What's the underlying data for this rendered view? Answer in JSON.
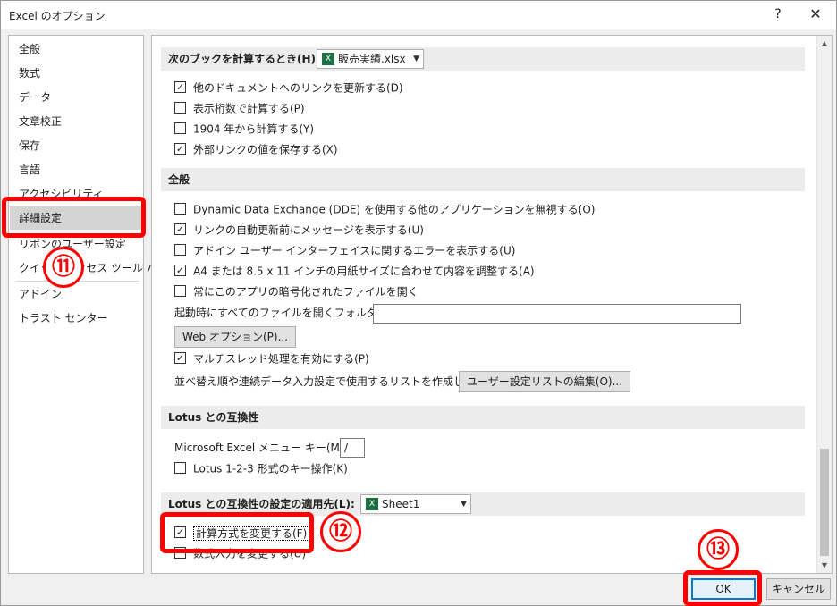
{
  "window": {
    "title": "Excel のオプション",
    "help_label": "?",
    "close_label": "✕"
  },
  "nav": {
    "items": [
      "全般",
      "数式",
      "データ",
      "文章校正",
      "保存",
      "言語",
      "アクセシビリティ",
      "詳細設定",
      "リボンのユーザー設定",
      "クイック アクセス ツール バー",
      "アドイン",
      "トラスト センター"
    ],
    "selected": "詳細設定"
  },
  "sections": {
    "workbook_calc": {
      "title": "次のブックを計算するとき(H):",
      "workbook": "販売実績.xlsx",
      "options": [
        {
          "label": "他のドキュメントへのリンクを更新する(D)",
          "checked": true
        },
        {
          "label": "表示桁数で計算する(P)",
          "checked": false
        },
        {
          "label": "1904 年から計算する(Y)",
          "checked": false
        },
        {
          "label": "外部リンクの値を保存する(X)",
          "checked": true
        }
      ]
    },
    "general": {
      "title": "全般",
      "options": [
        {
          "label": "Dynamic Data Exchange (DDE) を使用する他のアプリケーションを無視する(O)",
          "checked": false
        },
        {
          "label": "リンクの自動更新前にメッセージを表示する(U)",
          "checked": true
        },
        {
          "label": "アドイン ユーザー インターフェイスに関するエラーを表示する(U)",
          "checked": false
        },
        {
          "label": "A4 または 8.5 x 11 インチの用紙サイズに合わせて内容を調整する(A)",
          "checked": true
        },
        {
          "label": "常にこのアプリの暗号化されたファイルを開く",
          "checked": false
        }
      ],
      "startup_folder_label": "起動時にすべてのファイルを開くフォルダー(L):",
      "startup_folder_value": "",
      "web_options_button": "Web オプション(P)...",
      "multithread": {
        "label": "マルチスレッド処理を有効にする(P)",
        "checked": true
      },
      "custom_list_label": "並べ替え順や連続データ入力設定で使用するリストを作成します:",
      "custom_list_button": "ユーザー設定リストの編集(O)..."
    },
    "lotus": {
      "title": "Lotus との互換性",
      "menu_key_label": "Microsoft Excel メニュー キー(M):",
      "menu_key_value": "/",
      "nav_keys": {
        "label": "Lotus 1-2-3 形式のキー操作(K)",
        "checked": false
      }
    },
    "lotus_settings": {
      "title": "Lotus との互換性の設定の適用先(L):",
      "sheet": "Sheet1",
      "options": [
        {
          "label": "計算方式を変更する(F)",
          "checked": true
        },
        {
          "label": "数式入力を変更する(U)",
          "checked": false
        }
      ]
    }
  },
  "buttons": {
    "ok": "OK",
    "cancel": "キャンセル"
  },
  "annotations": {
    "step11": "⑪",
    "step12": "⑫",
    "step13": "⑬",
    "color": "#ff0000"
  }
}
